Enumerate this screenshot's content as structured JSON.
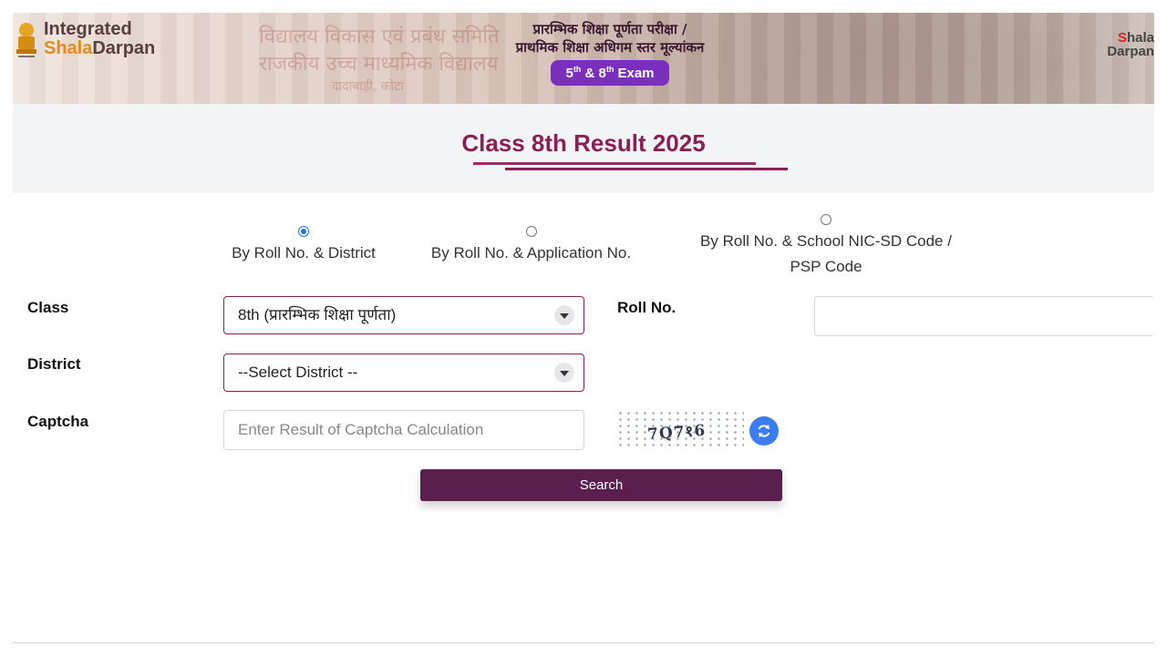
{
  "header": {
    "logo_left_line1": "Integrated",
    "logo_left_line2a": "Shala",
    "logo_left_line2b": "Darpan",
    "banner_faded_text1": "विद्यालय विकास एवं प्रबंध समिति",
    "banner_faded_text2": "राजकीय उच्च माध्यमिक विद्यालय",
    "banner_faded_text3": "दादाबाड़ी, कोटा",
    "hindi_line1": "प्रारम्भिक शिक्षा पूर्णता परीक्षा /",
    "hindi_line2": "प्राथमिक शिक्षा अधिगम स्तर मूल्यांकन",
    "exam_pill_a": "5",
    "exam_pill_sup1": "th",
    "exam_pill_b": " & 8",
    "exam_pill_sup2": "th",
    "exam_pill_c": " Exam",
    "logo_right_line1a": "S",
    "logo_right_line1b": "hala",
    "logo_right_line2": "Darpan"
  },
  "title": "Class 8th Result 2025",
  "search_options": [
    {
      "label": "By Roll No. & District",
      "selected": true
    },
    {
      "label": "By Roll No. & Application No.",
      "selected": false
    },
    {
      "label_line1": "By Roll No. & School NIC-SD Code /",
      "label_line2": "PSP Code",
      "selected": false
    }
  ],
  "form": {
    "class_label": "Class",
    "class_value": "8th (प्रारम्भिक शिक्षा पूर्णता)",
    "roll_label": "Roll No.",
    "roll_value": "",
    "district_label": "District",
    "district_value": "--Select District --",
    "captcha_label": "Captcha",
    "captcha_placeholder": "Enter Result of Captcha Calculation",
    "captcha_image_text": "7Q7१6",
    "search_button": "Search"
  },
  "colors": {
    "accent": "#8a1f56",
    "button": "#5c1e4f",
    "pill": "#7b2fbf",
    "radio_selected": "#1a73e8"
  }
}
